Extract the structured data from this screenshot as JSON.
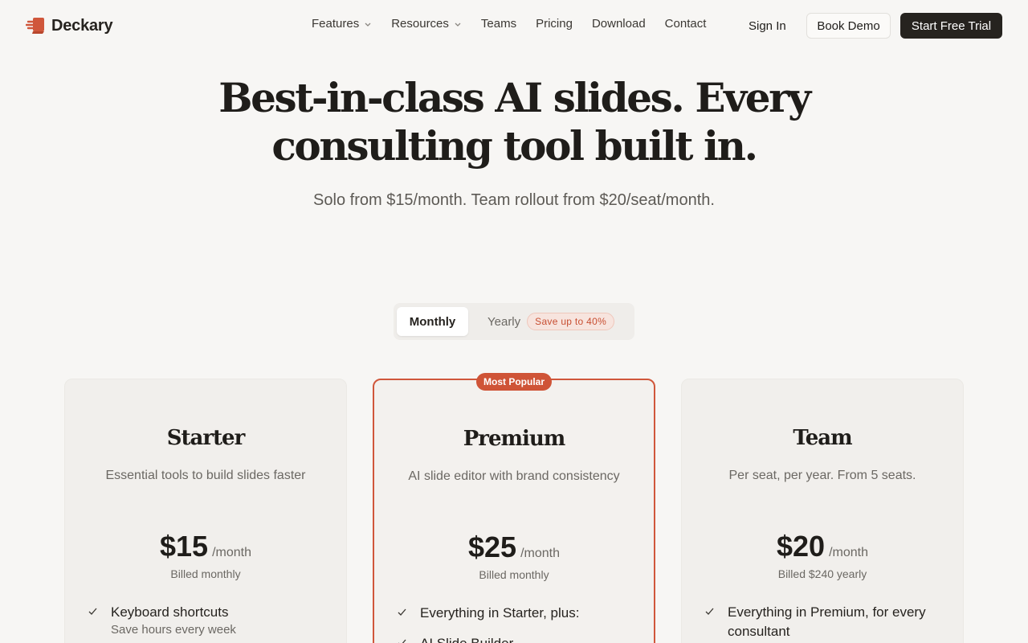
{
  "brand": {
    "name": "Deckary",
    "accent": "#d0573b",
    "logo_icon": "deckary-logo-icon"
  },
  "nav": {
    "items": [
      {
        "label": "Features",
        "dropdown": true
      },
      {
        "label": "Resources",
        "dropdown": true
      },
      {
        "label": "Teams",
        "dropdown": false
      },
      {
        "label": "Pricing",
        "dropdown": false
      },
      {
        "label": "Download",
        "dropdown": false
      },
      {
        "label": "Contact",
        "dropdown": false
      }
    ],
    "sign_in": "Sign In",
    "book_demo": "Book Demo",
    "start_trial": "Start Free Trial"
  },
  "hero": {
    "title": "Best-in-class AI slides. Every consulting tool built in.",
    "subtitle": "Solo from $15/month. Team rollout from $20/seat/month."
  },
  "billing_toggle": {
    "monthly": "Monthly",
    "yearly": "Yearly",
    "badge": "Save up to 40%",
    "selected": "Monthly"
  },
  "plans": [
    {
      "name": "Starter",
      "description": "Essential tools to build slides faster",
      "price": "$15",
      "period": "/month",
      "billed": "Billed monthly",
      "features": [
        {
          "text": "Keyboard shortcuts",
          "sub": "Save hours every week"
        }
      ]
    },
    {
      "name": "Premium",
      "badge": "Most Popular",
      "description": "AI slide editor with brand consistency",
      "price": "$25",
      "period": "/month",
      "billed": "Billed monthly",
      "features": [
        {
          "text": "Everything in Starter, plus:"
        },
        {
          "text": "AI Slide Builder"
        }
      ]
    },
    {
      "name": "Team",
      "description": "Per seat, per year. From 5 seats.",
      "price": "$20",
      "period": "/month",
      "billed": "Billed $240 yearly",
      "features": [
        {
          "text": "Everything in Premium, for every consultant"
        }
      ]
    }
  ]
}
